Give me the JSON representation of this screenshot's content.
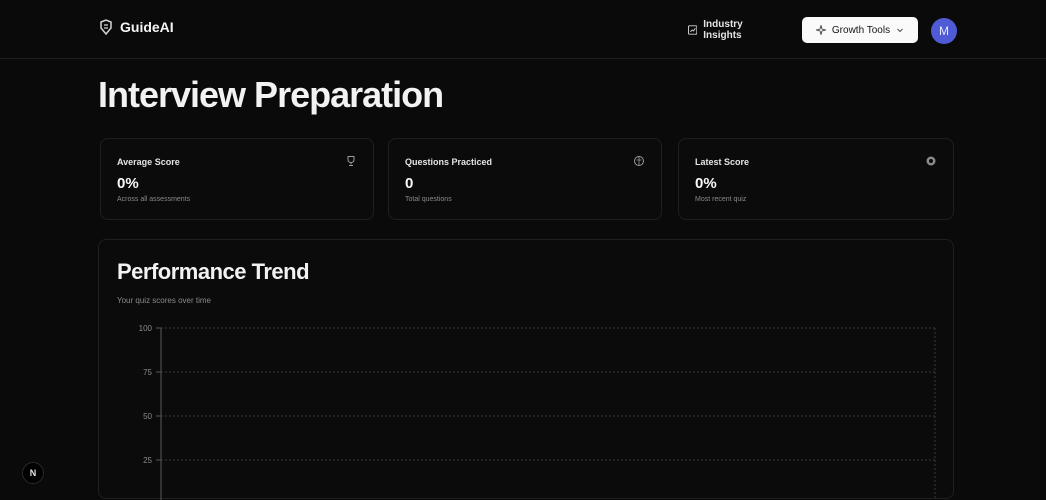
{
  "header": {
    "logo_text": "GuideAI",
    "industry_insights_label": "Industry Insights",
    "growth_tools_label": "Growth Tools",
    "avatar_initial": "M"
  },
  "page": {
    "title": "Interview Preparation"
  },
  "stats": [
    {
      "label": "Average Score",
      "value": "0%",
      "sub": "Across all assessments",
      "icon": "trophy-icon"
    },
    {
      "label": "Questions Practiced",
      "value": "0",
      "sub": "Total questions",
      "icon": "brain-icon"
    },
    {
      "label": "Latest Score",
      "value": "0%",
      "sub": "Most recent quiz",
      "icon": "target-icon"
    }
  ],
  "trend": {
    "title": "Performance Trend",
    "subtitle": "Your quiz scores over time"
  },
  "chart_data": {
    "type": "line",
    "x": [],
    "series": [],
    "y_ticks": [
      "100",
      "75",
      "50",
      "25"
    ],
    "ylim": [
      0,
      100
    ],
    "grid": true
  },
  "corner_badge": "N"
}
